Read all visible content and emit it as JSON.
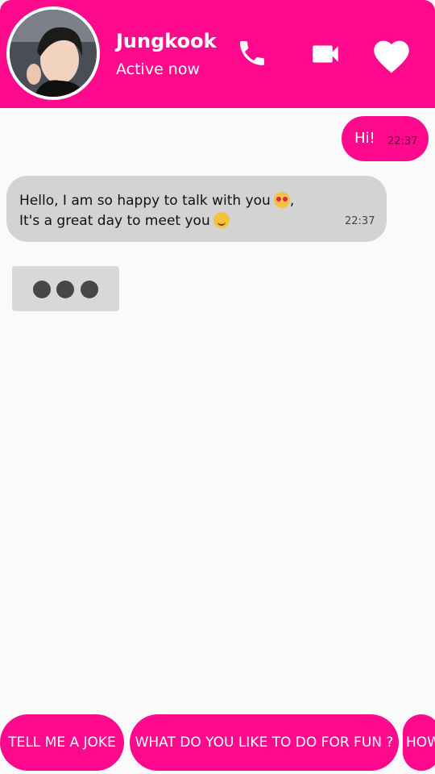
{
  "header": {
    "contact_name": "Jungkook",
    "status": "Active now",
    "accent_color": "#ff0a8c",
    "icons": [
      "phone-icon",
      "video-camera-icon",
      "heart-icon"
    ]
  },
  "messages": {
    "outgoing": {
      "text": "Hi!",
      "time": "22:37"
    },
    "incoming": {
      "line1": "Hello, I am so happy to talk with you",
      "line1_suffix": ",",
      "line2": "It's a great day to meet you",
      "time": "22:37",
      "emojis": [
        "heart-eyes-emoji",
        "smiling-emoji"
      ]
    }
  },
  "typing_indicator": {
    "dots": 3
  },
  "suggestions": [
    "TELL ME A JOKE",
    "WHAT DO YOU LIKE TO DO FOR FUN ?",
    "HOW"
  ]
}
